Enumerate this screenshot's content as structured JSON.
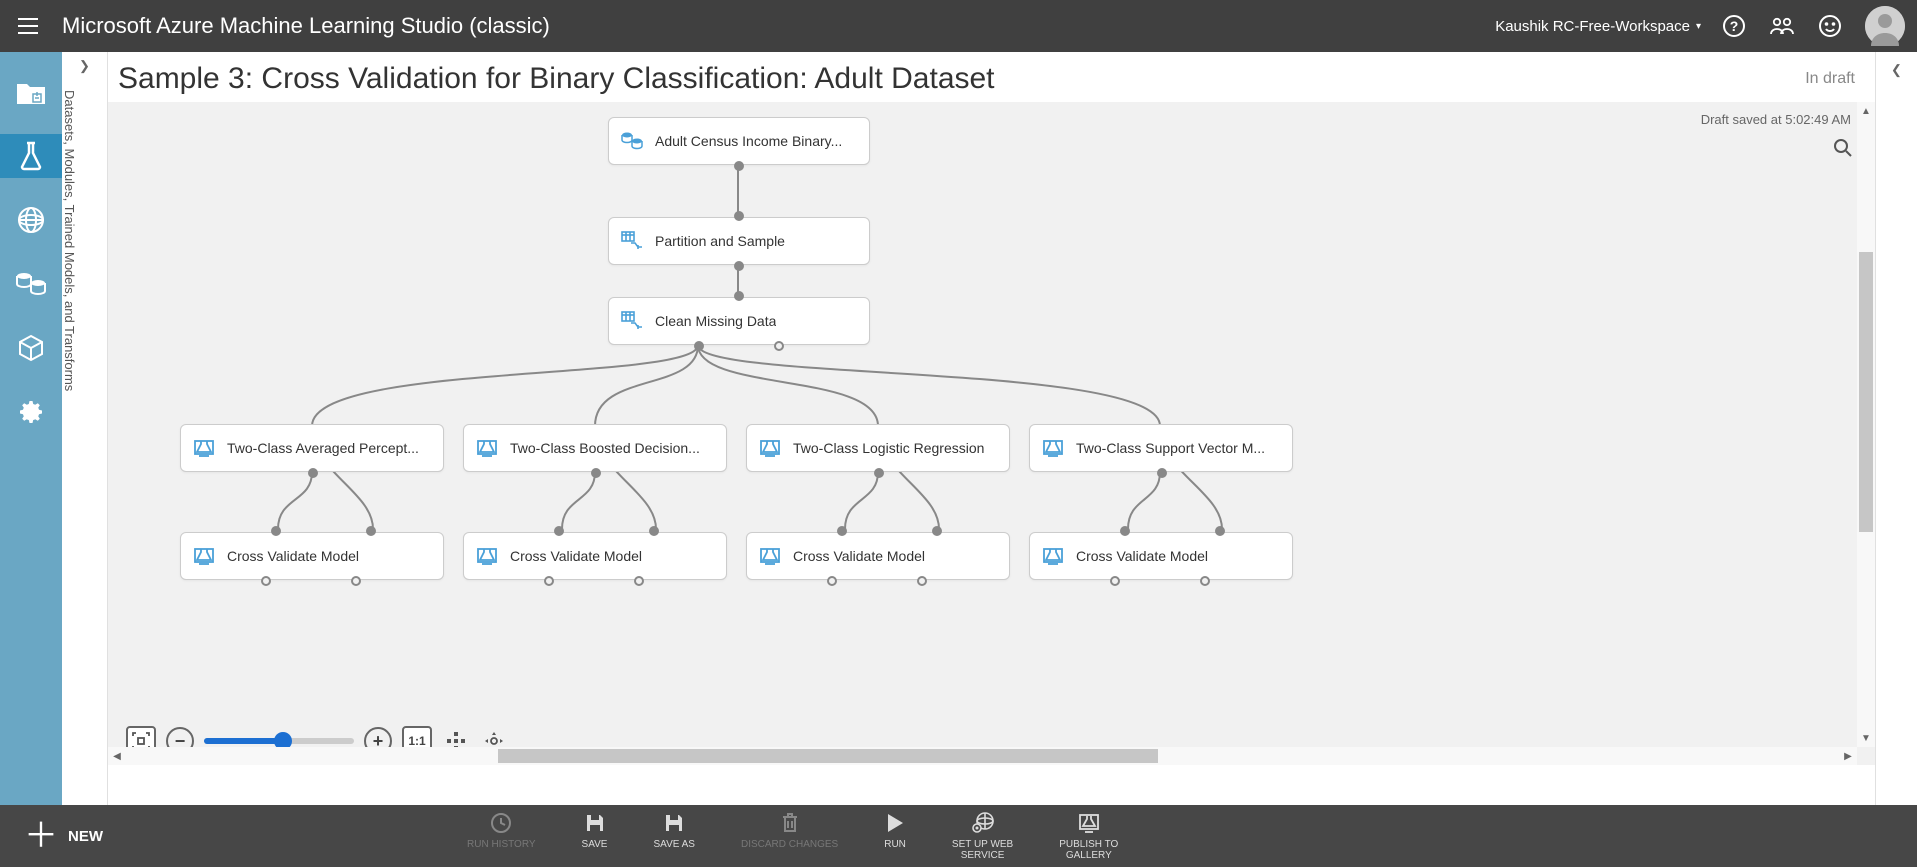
{
  "header": {
    "app_title": "Microsoft Azure Machine Learning Studio (classic)",
    "workspace": "Kaushik RC-Free-Workspace"
  },
  "palette": {
    "section_label": "Datasets, Modules, Trained Models, and Transforms"
  },
  "canvas": {
    "title": "Sample 3: Cross Validation for Binary Classification: Adult Dataset",
    "status": "In draft",
    "save_time": "Draft saved at 5:02:49 AM"
  },
  "nodes": {
    "n1": "Adult Census Income Binary...",
    "n2": "Partition and Sample",
    "n3": "Clean Missing Data",
    "alg1": "Two-Class Averaged Percept...",
    "alg2": "Two-Class Boosted Decision...",
    "alg3": "Two-Class Logistic Regression",
    "alg4": "Two-Class Support Vector M...",
    "cv1": "Cross Validate Model",
    "cv2": "Cross Validate Model",
    "cv3": "Cross Validate Model",
    "cv4": "Cross Validate Model"
  },
  "zoom": {
    "ratio_label": "1:1"
  },
  "bottom": {
    "new": "NEW",
    "run_history": "RUN HISTORY",
    "save": "SAVE",
    "save_as": "SAVE AS",
    "discard": "DISCARD CHANGES",
    "run": "RUN",
    "web_service": "SET UP WEB\nSERVICE",
    "gallery": "PUBLISH TO\nGALLERY"
  }
}
